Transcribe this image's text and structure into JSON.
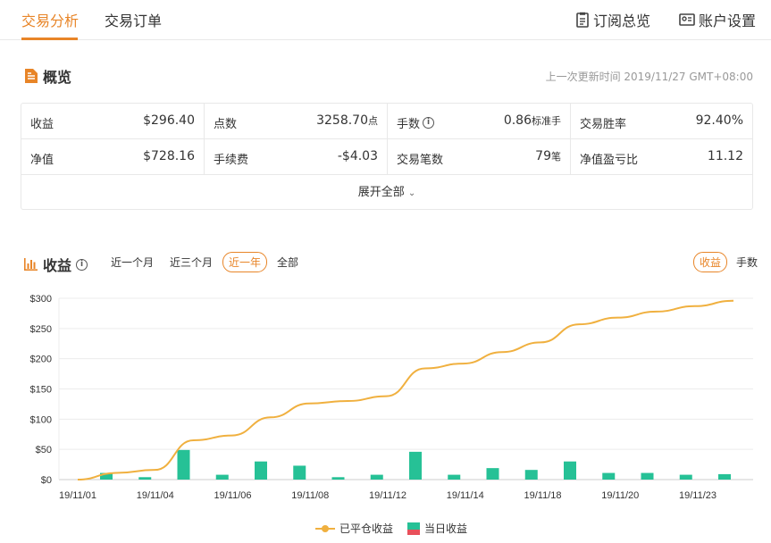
{
  "nav": {
    "tabs": [
      "交易分析",
      "交易订单"
    ],
    "right": [
      "订阅总览",
      "账户设置"
    ]
  },
  "overview": {
    "title": "概览",
    "update_label": "上一次更新时间 2019/11/27 GMT+08:00",
    "rows": [
      [
        {
          "label": "收益",
          "value": "$296.40",
          "unit": ""
        },
        {
          "label": "点数",
          "value": "3258.70",
          "unit": "点"
        },
        {
          "label": "手数",
          "value": "0.86",
          "unit": "标准手",
          "info": true
        },
        {
          "label": "交易胜率",
          "value": "92.40%",
          "unit": ""
        }
      ],
      [
        {
          "label": "净值",
          "value": "$728.16",
          "unit": ""
        },
        {
          "label": "手续费",
          "value": "-$4.03",
          "unit": ""
        },
        {
          "label": "交易笔数",
          "value": "79",
          "unit": "笔"
        },
        {
          "label": "净值盈亏比",
          "value": "11.12",
          "unit": ""
        }
      ]
    ],
    "expand_label": "展开全部"
  },
  "profit": {
    "title": "收益",
    "filters": [
      "近一个月",
      "近三个月",
      "近一年",
      "全部"
    ],
    "active_filter": "近一年",
    "toggle": [
      "收益",
      "手数"
    ],
    "active_toggle": "收益"
  },
  "colors": {
    "accent": "#e88528",
    "line": "#f0b03f",
    "bar": "#26c196",
    "bar_loss": "#e8505b"
  },
  "chart_data": {
    "type": "bar",
    "x_tick_labels": [
      "19/11/01",
      "19/11/04",
      "19/11/06",
      "19/11/08",
      "19/11/12",
      "19/11/14",
      "19/11/18",
      "19/11/20",
      "19/11/23"
    ],
    "y_tick_labels": [
      "$0",
      "$50",
      "$100",
      "$150",
      "$200",
      "$250",
      "$300"
    ],
    "ylim": [
      0,
      300
    ],
    "line_series": {
      "name": "已平仓收益",
      "values": [
        0,
        11,
        16,
        65,
        73,
        103,
        126,
        130,
        138,
        184,
        192,
        211,
        227,
        257,
        268,
        278,
        287,
        296
      ]
    },
    "bar_series": {
      "name": "当日收益",
      "values": [
        11,
        4,
        49,
        8,
        30,
        23,
        4,
        8,
        46,
        8,
        19,
        16,
        30,
        11,
        11,
        8,
        9
      ]
    },
    "legend_position": "bottom-center",
    "grid": true
  }
}
